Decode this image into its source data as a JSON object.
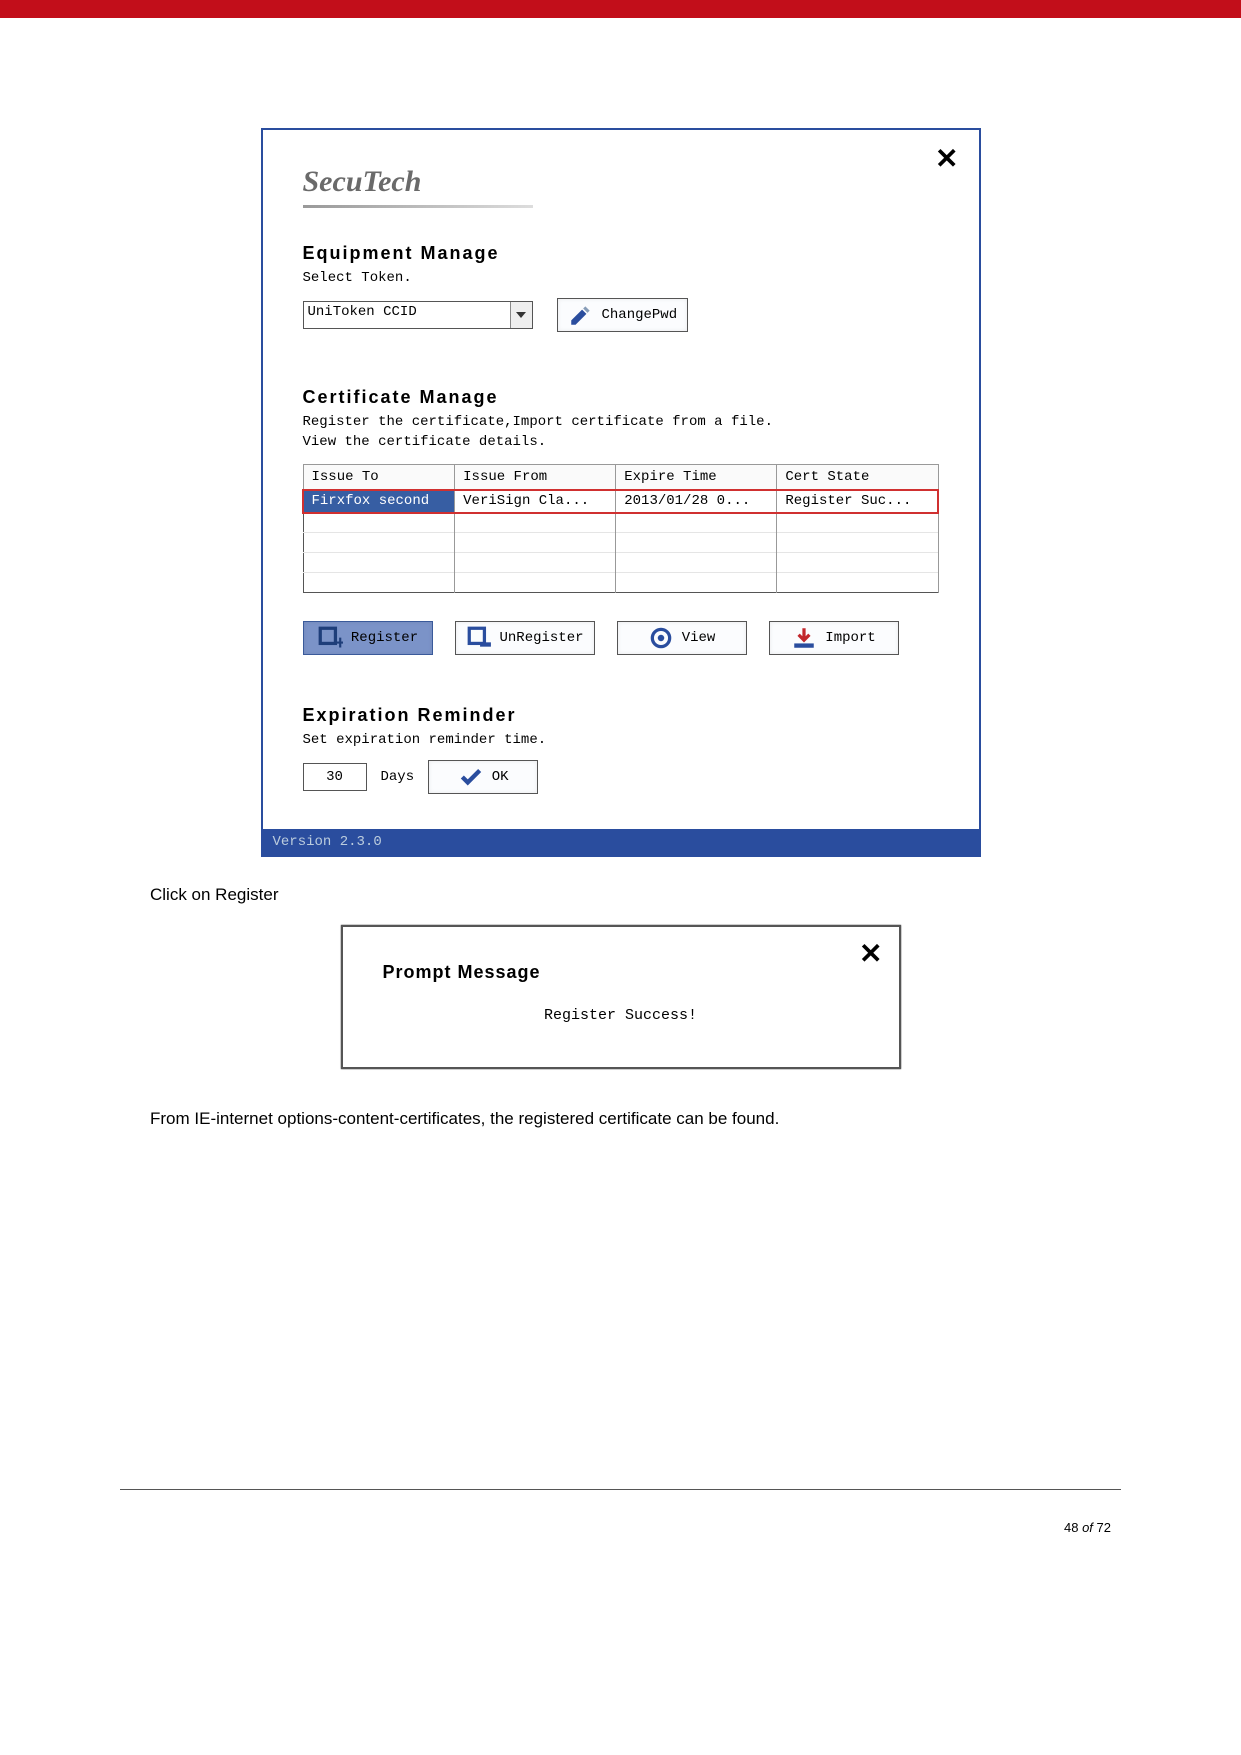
{
  "brand": "SecuTech",
  "equipment": {
    "title": "Equipment Manage",
    "subtitle": "Select Token.",
    "token": "UniToken CCID",
    "changePwdLabel": "ChangePwd"
  },
  "certificate": {
    "title": "Certificate Manage",
    "subtitle1": "Register the certificate,Import certificate from a file.",
    "subtitle2": "View the certificate details.",
    "headers": {
      "issueTo": "Issue To",
      "issueFrom": "Issue From",
      "expireTime": "Expire Time",
      "certState": "Cert State"
    },
    "row": {
      "issueTo": "Firxfox second",
      "issueFrom": "VeriSign Cla...",
      "expireTime": "2013/01/28 0...",
      "certState": "Register Suc..."
    },
    "buttons": {
      "register": "Register",
      "unregister": "UnRegister",
      "view": "View",
      "import": "Import"
    }
  },
  "expiration": {
    "title": "Expiration Reminder",
    "subtitle": "Set expiration reminder time.",
    "days": "30",
    "daysLabel": "Days",
    "okLabel": "OK"
  },
  "statusBar": "Version 2.3.0",
  "caption1": "Click on Register",
  "prompt": {
    "title": "Prompt Message",
    "message": "Register Success!"
  },
  "caption2": "From IE-internet options-content-certificates, the registered certificate can be found.",
  "footer": {
    "page": "48",
    "of": "of",
    "total": "72"
  }
}
